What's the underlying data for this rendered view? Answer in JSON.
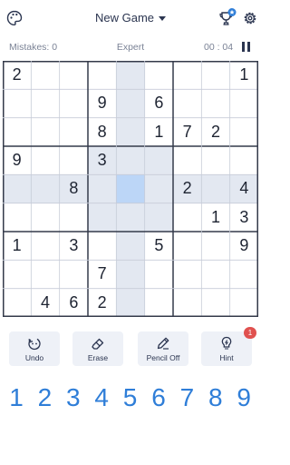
{
  "header": {
    "title": "New Game",
    "palette_icon": "palette-icon",
    "trophy_icon": "trophy-star-icon",
    "settings_icon": "gear-icon"
  },
  "status": {
    "mistakes": "Mistakes: 0",
    "difficulty": "Expert",
    "timer": "00 : 04",
    "pause_icon": "pause-icon"
  },
  "board": {
    "selected_row": 4,
    "selected_col": 4,
    "colors": {
      "selected": "#bcd6f7",
      "highlight": "#e3e8f1",
      "grid_thin": "#c7ccd8",
      "grid_thick": "#343a4a",
      "given_digit": "#1d2331"
    },
    "rows": [
      [
        "2",
        "",
        "",
        "",
        "",
        "",
        "",
        "",
        "1"
      ],
      [
        "",
        "",
        "",
        "9",
        "",
        "6",
        "",
        "",
        ""
      ],
      [
        "",
        "",
        "",
        "8",
        "",
        "1",
        "7",
        "2",
        ""
      ],
      [
        "9",
        "",
        "",
        "3",
        "",
        "",
        "",
        "",
        ""
      ],
      [
        "",
        "",
        "8",
        "",
        "",
        "",
        "2",
        "",
        "4"
      ],
      [
        "",
        "",
        "",
        "",
        "",
        "",
        "",
        "1",
        "3"
      ],
      [
        "1",
        "",
        "3",
        "",
        "",
        "5",
        "",
        "",
        "9"
      ],
      [
        "",
        "",
        "",
        "7",
        "",
        "",
        "",
        "",
        ""
      ],
      [
        "",
        "4",
        "6",
        "2",
        "",
        "",
        "",
        "",
        ""
      ]
    ]
  },
  "tools": [
    {
      "label": "Undo",
      "icon": "undo-icon"
    },
    {
      "label": "Erase",
      "icon": "eraser-icon"
    },
    {
      "label": "Pencil Off",
      "icon": "pencil-icon"
    },
    {
      "label": "Hint",
      "icon": "lightbulb-icon",
      "badge": "1"
    }
  ],
  "numpad": [
    "1",
    "2",
    "3",
    "4",
    "5",
    "6",
    "7",
    "8",
    "9"
  ],
  "accent_color": "#2f7ed8"
}
